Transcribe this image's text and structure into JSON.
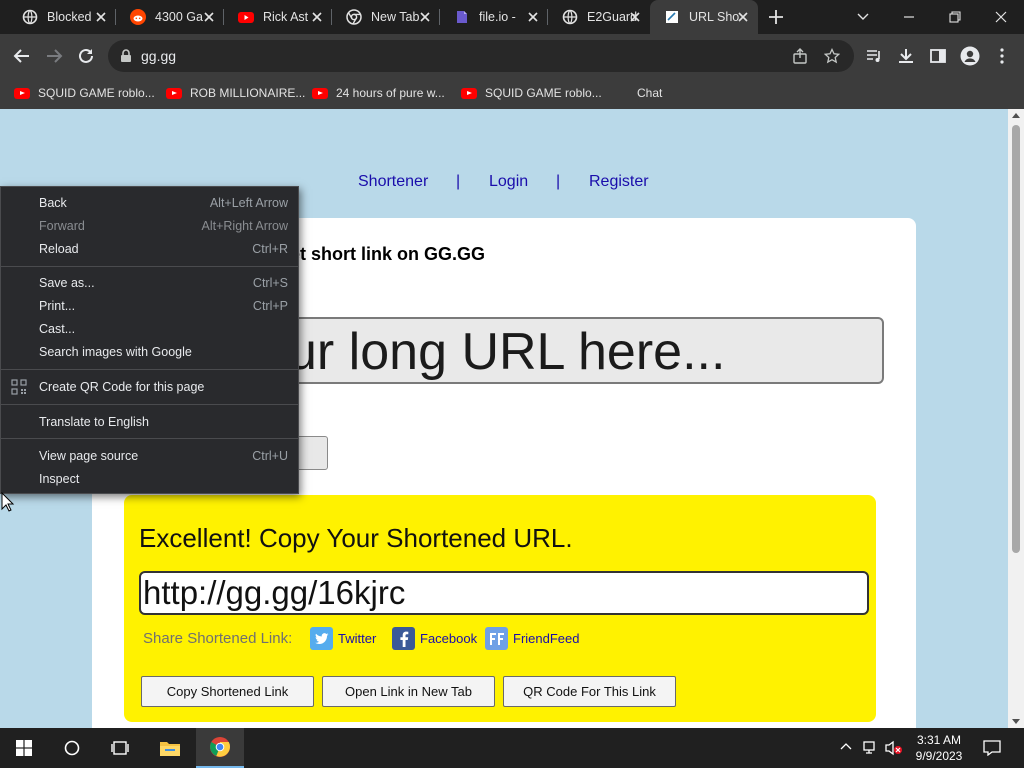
{
  "browser": {
    "tabs": [
      {
        "title": "Blocked",
        "icon": "blocked-icon"
      },
      {
        "title": "4300 Ga",
        "icon": "reddit-icon"
      },
      {
        "title": "Rick Ast",
        "icon": "youtube-icon"
      },
      {
        "title": "New Tab",
        "icon": "chrome-icon"
      },
      {
        "title": "file.io -",
        "icon": "file-icon"
      },
      {
        "title": "E2Guard",
        "icon": "blocked-icon"
      },
      {
        "title": "URL Sho",
        "icon": "page-icon"
      }
    ],
    "address": "gg.gg",
    "bookmarks": [
      {
        "label": "SQUID GAME roblo..."
      },
      {
        "label": "ROB MILLIONAIRE..."
      },
      {
        "label": "24 hours of pure w..."
      },
      {
        "label": "SQUID GAME roblo..."
      },
      {
        "label": "Chat"
      }
    ]
  },
  "page": {
    "nav": {
      "shortener": "Shortener",
      "sep1": "|",
      "login": "Login",
      "sep2": "|",
      "register": "Register"
    },
    "heading": "ener - Get short link on GG.GG",
    "url_placeholder": "ur long URL here...",
    "result": {
      "title": "Excellent! Copy Your Shortened URL.",
      "short_url": "http://gg.gg/16kjrc",
      "share_label": "Share Shortened Link:",
      "twitter": "Twitter",
      "facebook": "Facebook",
      "friendfeed": "FriendFeed",
      "copy_btn": "Copy Shortened Link",
      "open_btn": "Open Link in New Tab",
      "qr_btn": "QR Code For This Link"
    }
  },
  "context_menu": {
    "back": {
      "label": "Back",
      "shortcut": "Alt+Left Arrow"
    },
    "forward": {
      "label": "Forward",
      "shortcut": "Alt+Right Arrow"
    },
    "reload": {
      "label": "Reload",
      "shortcut": "Ctrl+R"
    },
    "save": {
      "label": "Save as...",
      "shortcut": "Ctrl+S"
    },
    "print": {
      "label": "Print...",
      "shortcut": "Ctrl+P"
    },
    "cast": {
      "label": "Cast..."
    },
    "search_images": {
      "label": "Search images with Google"
    },
    "qr": {
      "label": "Create QR Code for this page"
    },
    "translate": {
      "label": "Translate to English"
    },
    "view_source": {
      "label": "View page source",
      "shortcut": "Ctrl+U"
    },
    "inspect": {
      "label": "Inspect"
    }
  },
  "taskbar": {
    "time": "3:31 AM",
    "date": "9/9/2023"
  },
  "colors": {
    "page_bg": "#b9d9e9",
    "result_bg": "#fff200",
    "link": "#1a0dab",
    "menu_bg": "#292a2d"
  }
}
